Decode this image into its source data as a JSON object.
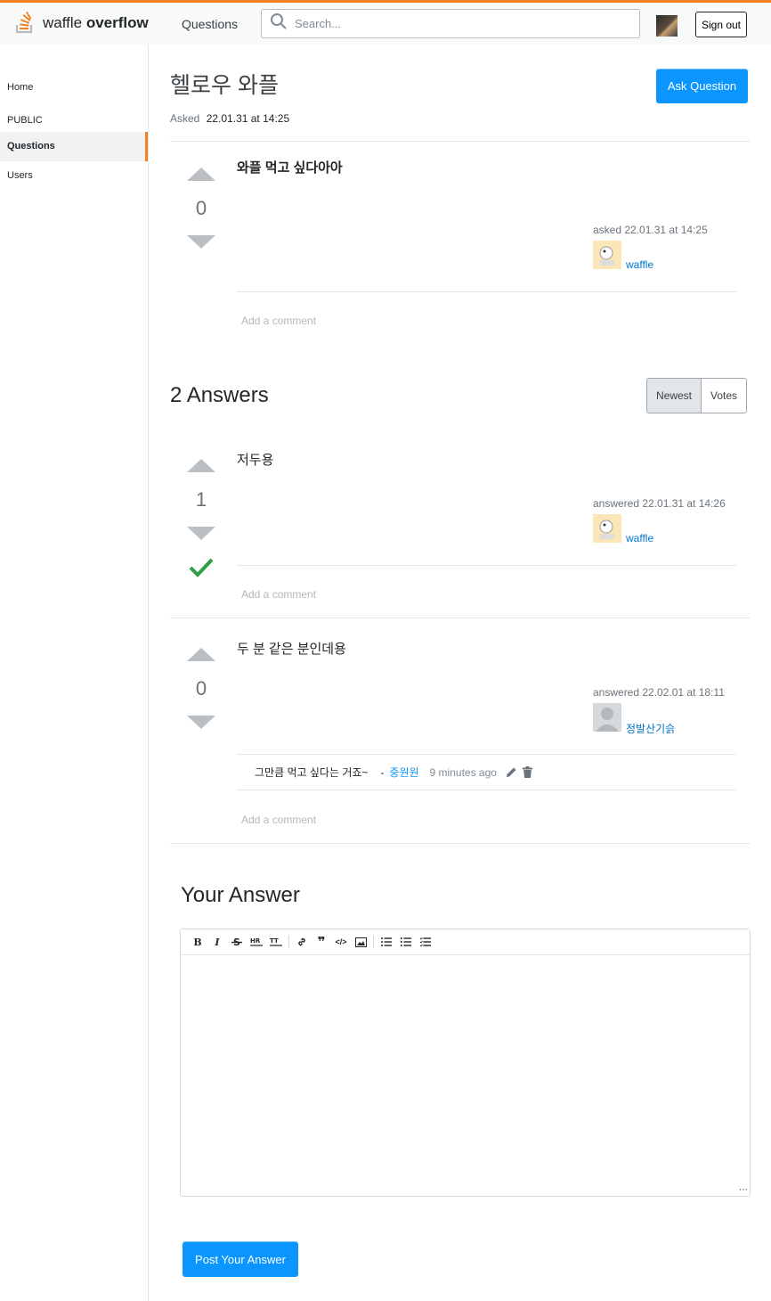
{
  "header": {
    "logo_text_light": "waffle",
    "logo_text_bold": "overflow",
    "nav_questions": "Questions",
    "search_placeholder": "Search...",
    "signout_label": "Sign out"
  },
  "sidebar": {
    "home": "Home",
    "section": "PUBLIC",
    "questions": "Questions",
    "users": "Users"
  },
  "question": {
    "title": "헬로우 와플",
    "asked_label": "Asked",
    "asked_time": "22.01.31 at 14:25",
    "ask_button": "Ask Question",
    "votes": "0",
    "body": "와플 먹고 싶다아아",
    "meta_time": "asked 22.01.31 at 14:25",
    "author": "waffle",
    "add_comment": "Add a comment"
  },
  "answers_header": {
    "count_label": "2 Answers",
    "sort_newest": "Newest",
    "sort_votes": "Votes"
  },
  "answers": [
    {
      "votes": "1",
      "accepted": true,
      "body": "저두용",
      "meta_time": "answered 22.01.31 at 14:26",
      "author": "waffle",
      "add_comment": "Add a comment"
    },
    {
      "votes": "0",
      "accepted": false,
      "body": "두 분 같은 분인데용",
      "meta_time": "answered 22.02.01 at 18:11",
      "author": "정발산기슭",
      "comment": {
        "text": "그만큼 먹고 싶다는 거죠~",
        "dash": "-",
        "user": "중원원",
        "time": "9 minutes ago"
      },
      "add_comment": "Add a comment"
    }
  ],
  "your_answer": {
    "heading": "Your Answer",
    "post_button": "Post Your Answer",
    "toolbar_icons": [
      "bold-icon",
      "italic-icon",
      "strikethrough-icon",
      "hr-icon",
      "heading-icon",
      "link-icon",
      "quote-icon",
      "code-icon",
      "image-icon",
      "bullet-list-icon",
      "numbered-list-icon",
      "task-list-icon"
    ]
  },
  "colors": {
    "accent": "#f48225",
    "primary": "#0a95ff",
    "accepted": "#2f9e44"
  }
}
